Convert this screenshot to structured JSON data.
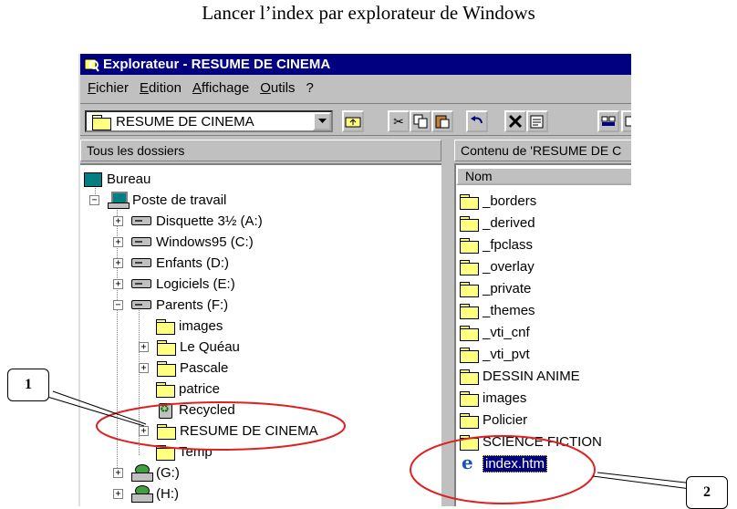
{
  "page_title": "Lancer l’index par explorateur de Windows",
  "window": {
    "title": "Explorateur - RESUME DE CINEMA",
    "menu": [
      "Fichier",
      "Edition",
      "Affichage",
      "Outils",
      "?"
    ],
    "address_value": "RESUME DE CINEMA",
    "toolbar_icons": [
      "up-folder-icon",
      "cut-icon",
      "copy-icon",
      "paste-icon",
      "undo-icon",
      "delete-icon",
      "properties-icon",
      "large-icons-icon",
      "small-icons-icon"
    ]
  },
  "left_pane": {
    "header": "Tous les dossiers",
    "tree": [
      {
        "label": "Bureau",
        "icon": "desktop-icon"
      },
      {
        "label": "Poste de travail",
        "icon": "computer-icon"
      },
      {
        "label": "Disquette 3½ (A:)",
        "icon": "drive-icon"
      },
      {
        "label": "Windows95 (C:)",
        "icon": "drive-icon"
      },
      {
        "label": "Enfants (D:)",
        "icon": "drive-icon"
      },
      {
        "label": "Logiciels (E:)",
        "icon": "drive-icon"
      },
      {
        "label": "Parents (F:)",
        "icon": "drive-icon"
      },
      {
        "label": "images",
        "icon": "folder-icon"
      },
      {
        "label": "Le Quéau",
        "icon": "folder-icon"
      },
      {
        "label": "Pascale",
        "icon": "folder-icon"
      },
      {
        "label": "patrice",
        "icon": "folder-icon"
      },
      {
        "label": "Recycled",
        "icon": "recycle-bin-icon"
      },
      {
        "label": "RESUME DE CINEMA",
        "icon": "open-folder-icon"
      },
      {
        "label": "Temp",
        "icon": "folder-icon"
      },
      {
        "label": "(G:)",
        "icon": "network-drive-icon"
      },
      {
        "label": "(H:)",
        "icon": "network-drive-icon"
      }
    ]
  },
  "right_pane": {
    "header": "Contenu de 'RESUME DE C",
    "column": "Nom",
    "items": [
      "_borders",
      "_derived",
      "_fpclass",
      "_overlay",
      "_private",
      "_themes",
      "_vti_cnf",
      "_vti_pvt",
      "DESSIN ANIME",
      "images",
      "Policier",
      "SCIENCE FICTION",
      "index.htm"
    ]
  },
  "callouts": [
    "1",
    "2"
  ],
  "accent": {
    "titlebar": "#000080",
    "highlight": "#e02020"
  }
}
